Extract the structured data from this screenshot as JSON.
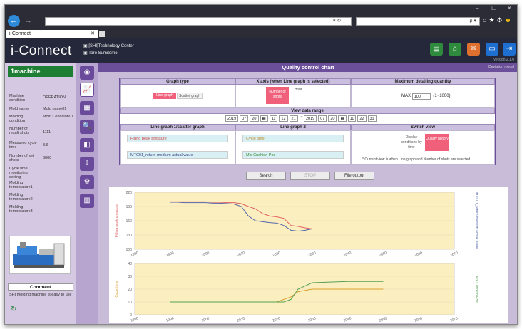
{
  "browser": {
    "url": "",
    "refresh_glyph": "▾ ↻",
    "search_icon": "ρ ▾",
    "tab_title": "i-Connect",
    "tab_close": "✕",
    "window_controls": [
      "−",
      "☐",
      "✕"
    ]
  },
  "app": {
    "logo": "i-Connect",
    "org": "[SHI]Technology Center",
    "user": "Taro Sumitomo",
    "version": "version 2.1.0"
  },
  "machine_panel": {
    "title": "1machine",
    "fields": [
      {
        "key": "Machine condition",
        "value": "OPERATION"
      },
      {
        "key": "Mold name",
        "value": "Mold name01"
      },
      {
        "key": "Molding condition",
        "value": "Mold Condition01"
      },
      {
        "key": "Number of result shots",
        "value": "1111"
      },
      {
        "key": "Measured cycle time",
        "value": "3.6"
      },
      {
        "key": "Number of set shots",
        "value": "3000"
      },
      {
        "key": "Cycle time monitoring setting",
        "value": ""
      },
      {
        "key": "Molding temperature1",
        "value": ""
      },
      {
        "key": "Molding temperature2",
        "value": ""
      },
      {
        "key": "Molding temperature3",
        "value": ""
      }
    ],
    "comment_header": "Comment",
    "comment_text": "SHI molding machine is easy to use"
  },
  "main": {
    "title": "Quality control chart",
    "deviation_link": "Deviation modal",
    "graph_type_header": "Graph type",
    "graph_type_options": [
      "Line graph",
      "Scatter graph"
    ],
    "xaxis_header": "X axis (when Line graph is selected)",
    "xaxis_options": [
      "Number of shots",
      "Hour"
    ],
    "max_header": "Maximum detailing quantity",
    "max_label": "MAX",
    "max_value": "100",
    "max_range": "(1~1000)",
    "range_header": "View data range",
    "range_from": [
      "2019",
      "07",
      "20",
      "11",
      "12",
      "21"
    ],
    "range_to": [
      "2019",
      "07",
      "20",
      "11",
      "22",
      "31"
    ],
    "range_sep": "~",
    "line1_header": "Line graph 1/scatter graph",
    "line2_header": "Line graph 2",
    "switch_header": "Switch view",
    "line1_select1": "Filling peak pressure",
    "line1_select2": "MTC01_return medium actual value",
    "line2_select1": "Cycle time",
    "line2_select2": "Mix Cushion Pos",
    "switch_options": [
      "Display conditions by time",
      "Quality history"
    ],
    "note": "* Current view is when Line graph and Number of shots are selected.",
    "search_btn": "Search",
    "stop_btn": "STOP",
    "file_btn": "File output"
  },
  "chart_data": [
    {
      "type": "line",
      "ylabel": "Filling peak pressure",
      "y2label": "MTC01_return medium actual value",
      "x": [
        1990,
        1992,
        1994,
        1996,
        1998,
        2000,
        2002,
        2004,
        2006,
        2008,
        2010,
        2012,
        2014,
        2016,
        2018,
        2020,
        2022,
        2024,
        2026,
        2028,
        2030
      ],
      "series": [
        {
          "name": "Filling peak pressure",
          "color": "#e06060",
          "values": [
            200,
            200,
            200,
            200,
            200,
            200,
            199,
            199,
            198,
            198,
            196,
            190,
            185,
            175,
            170,
            168,
            165,
            150,
            148,
            145,
            143
          ]
        },
        {
          "name": "MTC01_return medium actual value",
          "color": "#5566aa",
          "values": [
            199,
            199,
            198,
            198,
            198,
            198,
            197,
            197,
            196,
            195,
            190,
            170,
            160,
            158,
            156,
            155,
            150,
            140,
            138,
            140,
            143
          ]
        }
      ],
      "xlim": [
        1980,
        2070
      ],
      "ylim": [
        100,
        220
      ]
    },
    {
      "type": "line",
      "ylabel": "Cycle time",
      "y2label": "Mix Cushion Pos",
      "x": [
        1990,
        2000,
        2010,
        2015,
        2020,
        2022,
        2024,
        2026,
        2030,
        2040,
        2050
      ],
      "series": [
        {
          "name": "Cycle time",
          "color": "#d9a030",
          "values": [
            10,
            10,
            10,
            10,
            10,
            12,
            14,
            18,
            20,
            20,
            20
          ]
        },
        {
          "name": "Mix Cushion Pos",
          "color": "#55a055",
          "values": [
            10,
            10,
            10,
            10,
            10,
            10,
            12,
            20,
            25,
            26,
            26
          ]
        }
      ],
      "xlim": [
        1980,
        2070
      ],
      "ylim": [
        0,
        40
      ]
    }
  ]
}
